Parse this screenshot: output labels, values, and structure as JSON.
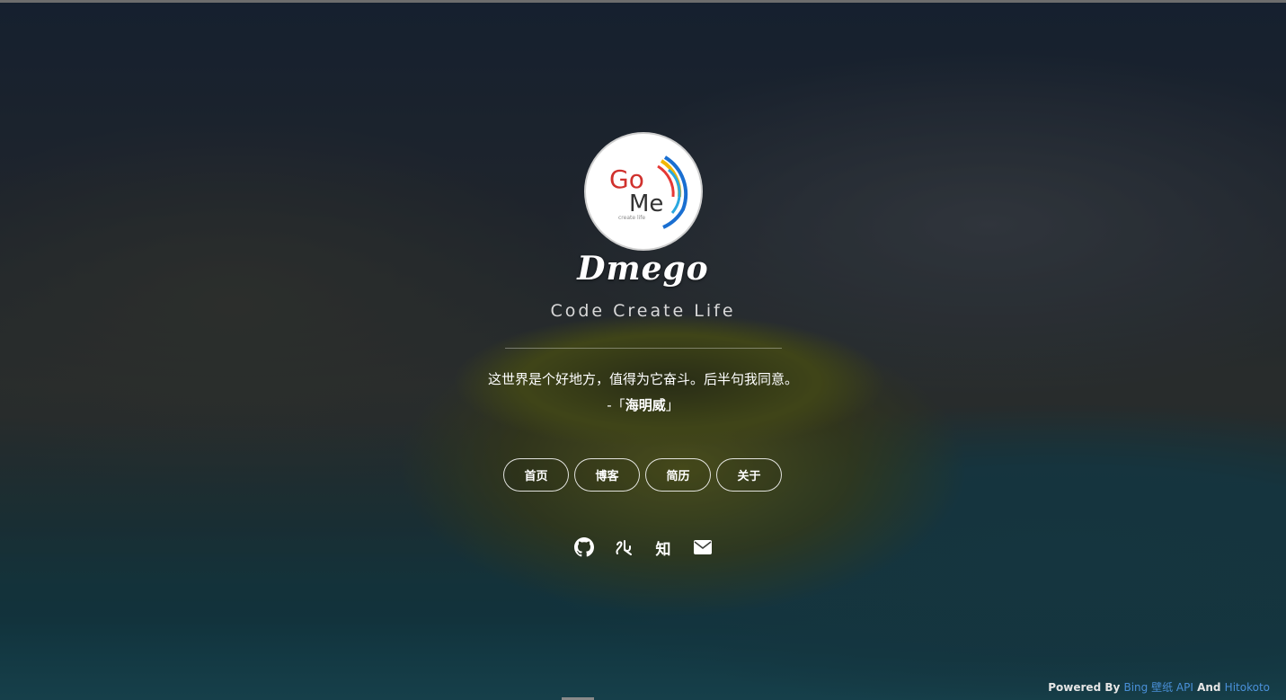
{
  "site": {
    "title": "Dmego",
    "subtitle": "Code Create Life",
    "logo_text_1": "Go",
    "logo_text_2": "Me",
    "logo_small": "create life"
  },
  "quote": {
    "text": "这世界是个好地方，值得为它奋斗。后半句我同意。",
    "prefix": "-「",
    "author": "海明威",
    "suffix": "」"
  },
  "nav": [
    {
      "label": "首页"
    },
    {
      "label": "博客"
    },
    {
      "label": "简历"
    },
    {
      "label": "关于"
    }
  ],
  "social": {
    "github": "github-icon",
    "blog": "blog-icon",
    "zhihu": "知",
    "email": "email-icon"
  },
  "footer": {
    "powered_by": "Powered By ",
    "bing_api": "Bing 壁纸 API",
    "and": " And ",
    "hitokoto": "Hitokoto"
  },
  "colors": {
    "link": "#4a90d9",
    "logo_red": "#d0312d",
    "logo_blue": "#1a6fd1"
  }
}
